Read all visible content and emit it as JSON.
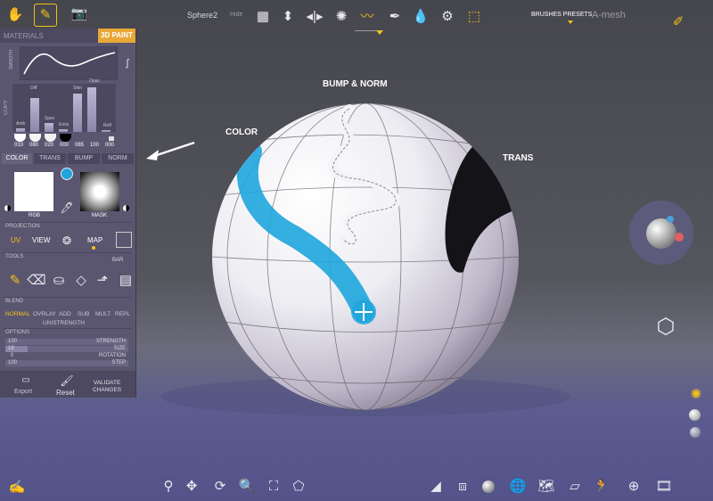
{
  "topbar": {
    "object_name": "Sphere2",
    "hide_label": "Hide",
    "brushes_presets_label": "BRUSHES PRESETS",
    "amesh_label": "A-mesh"
  },
  "panel": {
    "materials_label": "MATERIALS",
    "paint_label": "3D PAINT",
    "smooth_label": "SMOOTH",
    "copy_label": "COPY",
    "slider_labels": [
      "Amb",
      "Diff",
      "Spec",
      "Emis",
      "Shin",
      "Opac",
      "Refl"
    ],
    "slider_values": [
      "010",
      "080",
      "020",
      "000",
      "085",
      "100",
      "000"
    ],
    "slider_levels": [
      0.08,
      0.7,
      0.18,
      0.05,
      0.8,
      0.92,
      0.04
    ],
    "channel_tabs": [
      "COLOR",
      "TRANS",
      "BUMP",
      "NORM"
    ],
    "rgb_label": "RGB",
    "mask_label": "MASK",
    "projection_label": "PROJECTION",
    "projection_options": [
      "UV",
      "VIEW",
      "MAP"
    ],
    "tools_label": "TOOLS",
    "bar_label": "BAR",
    "blend_label": "BLEND",
    "blend_modes": [
      "NORMAL",
      "OVRLAY",
      "ADD",
      "SUB",
      "MULT",
      "REPL"
    ],
    "unistrength_label": "UNISTRENGTH",
    "options_label": "OPTIONS",
    "option_rows": [
      {
        "value": "100",
        "label": "STRENGTH"
      },
      {
        "value": "18",
        "label": "SIZE"
      },
      {
        "value": "0",
        "label": "ROTATION"
      },
      {
        "value": "100",
        "label": "STEP"
      }
    ],
    "export_label": "Export",
    "reset_label": "Reset",
    "validate_label_1": "VALIDATE",
    "validate_label_2": "CHANGES"
  },
  "annotations": {
    "bump_norm": "BUMP & NORM",
    "color": "COLOR",
    "trans": "TRANS"
  },
  "colors": {
    "accent": "#f2c21c",
    "paint_blue": "#1fa5dd",
    "panel_bg": "#5b5670"
  }
}
